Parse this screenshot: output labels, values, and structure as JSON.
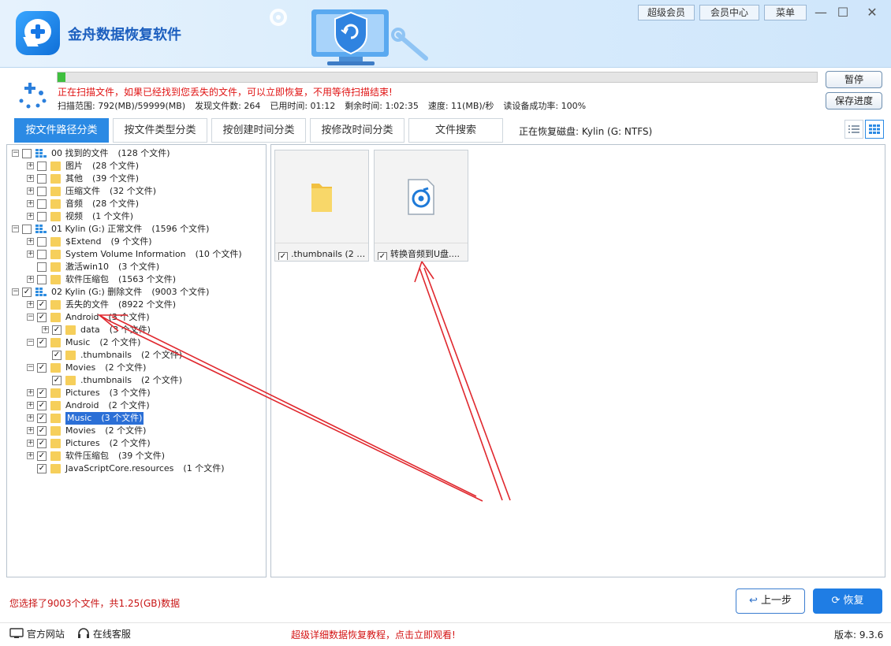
{
  "app": {
    "title": "金舟数据恢复软件",
    "top_buttons": [
      "超级会员",
      "会员中心",
      "菜单"
    ],
    "window_controls": [
      "—",
      "☐",
      "✕"
    ]
  },
  "scan": {
    "progress_fraction": 0.01,
    "warning": "正在扫描文件，如果已经找到您丢失的文件，可以立即恢复，不用等待扫描结束!",
    "stats": [
      "扫描范围: 792(MB)/59999(MB)",
      "发现文件数: 264",
      "已用时间: 01:12",
      "剩余时间: 1:02:35",
      "速度: 11(MB)/秒",
      "读设备成功率: 100%"
    ],
    "pause_label": "暂停",
    "save_progress_label": "保存进度"
  },
  "tabs": [
    "按文件路径分类",
    "按文件类型分类",
    "按创建时间分类",
    "按修改时间分类",
    "文件搜索"
  ],
  "disk_label": "正在恢复磁盘: Kylin (G: NTFS)",
  "tree": [
    {
      "label": "00 找到的文件",
      "count": "(128 个文件)",
      "depth": 0,
      "kind": "drive",
      "exp": "−",
      "checked": false
    },
    {
      "label": "图片",
      "count": "(28 个文件)",
      "depth": 1,
      "kind": "folder",
      "exp": "+",
      "checked": false
    },
    {
      "label": "其他",
      "count": "(39 个文件)",
      "depth": 1,
      "kind": "folder",
      "exp": "+",
      "checked": false
    },
    {
      "label": "压缩文件",
      "count": "(32 个文件)",
      "depth": 1,
      "kind": "folder",
      "exp": "+",
      "checked": false
    },
    {
      "label": "音频",
      "count": "(28 个文件)",
      "depth": 1,
      "kind": "folder",
      "exp": "+",
      "checked": false
    },
    {
      "label": "视频",
      "count": "(1 个文件)",
      "depth": 1,
      "kind": "folder",
      "exp": "+",
      "checked": false
    },
    {
      "label": "01 Kylin (G:) 正常文件",
      "count": "(1596 个文件)",
      "depth": 0,
      "kind": "drive",
      "exp": "−",
      "checked": false
    },
    {
      "label": "$Extend",
      "count": "(9 个文件)",
      "depth": 1,
      "kind": "folder",
      "exp": "+",
      "checked": false
    },
    {
      "label": "System Volume Information",
      "count": "(10 个文件)",
      "depth": 1,
      "kind": "folder",
      "exp": "+",
      "checked": false
    },
    {
      "label": "激活win10",
      "count": "(3 个文件)",
      "depth": 1,
      "kind": "folder",
      "exp": "",
      "checked": false
    },
    {
      "label": "软件压缩包",
      "count": "(1563 个文件)",
      "depth": 1,
      "kind": "folder",
      "exp": "+",
      "checked": false
    },
    {
      "label": "02 Kylin (G:) 删除文件",
      "count": "(9003 个文件)",
      "depth": 0,
      "kind": "drive",
      "exp": "−",
      "checked": true
    },
    {
      "label": "丢失的文件",
      "count": "(8922 个文件)",
      "depth": 1,
      "kind": "folder",
      "exp": "+",
      "checked": true
    },
    {
      "label": "Android",
      "count": "(3 个文件)",
      "depth": 1,
      "kind": "folder",
      "exp": "−",
      "checked": true
    },
    {
      "label": "data",
      "count": "(3 个文件)",
      "depth": 2,
      "kind": "folder",
      "exp": "+",
      "checked": true
    },
    {
      "label": "Music",
      "count": "(2 个文件)",
      "depth": 1,
      "kind": "folder",
      "exp": "−",
      "checked": true
    },
    {
      "label": ".thumbnails",
      "count": "(2 个文件)",
      "depth": 2,
      "kind": "folder",
      "exp": "",
      "checked": true
    },
    {
      "label": "Movies",
      "count": "(2 个文件)",
      "depth": 1,
      "kind": "folder",
      "exp": "−",
      "checked": true
    },
    {
      "label": ".thumbnails",
      "count": "(2 个文件)",
      "depth": 2,
      "kind": "folder",
      "exp": "",
      "checked": true
    },
    {
      "label": "Pictures",
      "count": "(3 个文件)",
      "depth": 1,
      "kind": "folder",
      "exp": "+",
      "checked": true
    },
    {
      "label": "Android",
      "count": "(2 个文件)",
      "depth": 1,
      "kind": "folder",
      "exp": "+",
      "checked": true
    },
    {
      "label": "Music",
      "count": "(3 个文件)",
      "depth": 1,
      "kind": "folder",
      "exp": "+",
      "checked": true,
      "selected": true
    },
    {
      "label": "Movies",
      "count": "(2 个文件)",
      "depth": 1,
      "kind": "folder",
      "exp": "+",
      "checked": true
    },
    {
      "label": "Pictures",
      "count": "(2 个文件)",
      "depth": 1,
      "kind": "folder",
      "exp": "+",
      "checked": true
    },
    {
      "label": "软件压缩包",
      "count": "(39 个文件)",
      "depth": 1,
      "kind": "folder",
      "exp": "+",
      "checked": true
    },
    {
      "label": "JavaScriptCore.resources",
      "count": "(1 个文件)",
      "depth": 1,
      "kind": "folder",
      "exp": "",
      "checked": true
    }
  ],
  "files": [
    {
      "name": ".thumbnails  (2 个...",
      "icon": "folder-icon",
      "checked": true
    },
    {
      "name": "转换音频到U盘....",
      "icon": "audio-file-icon",
      "checked": true
    }
  ],
  "bottom": {
    "summary": "您选择了9003个文件，共1.25(GB)数据",
    "back_label": "上一步",
    "recover_label": "恢复"
  },
  "footer": {
    "website_label": "官方网站",
    "service_label": "在线客服",
    "tutorial_label": "超级详细数据恢复教程，点击立即观看!",
    "version_label": "版本: 9.3.6"
  },
  "colors": {
    "accent": "#2b8ae4",
    "warning_red": "#e01414",
    "folder_yellow": "#f6cf5b",
    "progress_green": "#3fbf3f"
  }
}
